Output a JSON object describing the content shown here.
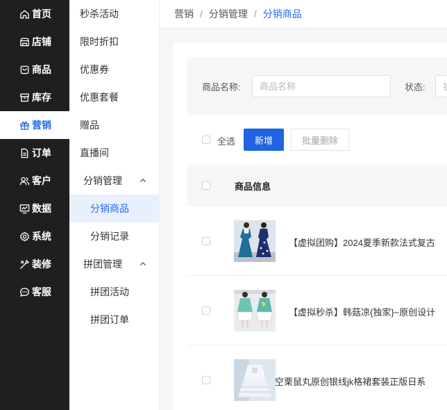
{
  "nav_primary": [
    {
      "label": "首页",
      "icon": "home-icon"
    },
    {
      "label": "店铺",
      "icon": "shop-icon"
    },
    {
      "label": "商品",
      "icon": "goods-icon"
    },
    {
      "label": "库存",
      "icon": "inventory-icon"
    },
    {
      "label": "营销",
      "icon": "gift-icon",
      "active": true
    },
    {
      "label": "订单",
      "icon": "order-icon"
    },
    {
      "label": "客户",
      "icon": "customer-icon"
    },
    {
      "label": "数据",
      "icon": "chart-icon"
    },
    {
      "label": "系统",
      "icon": "gear-icon"
    },
    {
      "label": "装修",
      "icon": "decoration-icon"
    },
    {
      "label": "客服",
      "icon": "chat-icon"
    }
  ],
  "nav_secondary": {
    "items": [
      "秒杀活动",
      "限时折扣",
      "优惠券",
      "优惠套餐",
      "赠品",
      "直播间"
    ],
    "group_distribution": {
      "label": "分销管理",
      "children": [
        "分销商品",
        "分销记录"
      ]
    },
    "group_pintuan": {
      "label": "拼团管理",
      "children": [
        "拼团活动",
        "拼团订单"
      ]
    }
  },
  "breadcrumb": [
    "营销",
    "分销管理",
    "分销商品"
  ],
  "breadcrumb_separator": "/",
  "filter": {
    "name_label": "商品名称:",
    "name_value": "",
    "name_placeholder": "商品名称",
    "status_label": "状态:",
    "status_placeholder": "状"
  },
  "toolbar": {
    "select_all_label": "全选",
    "add_label": "新增",
    "batch_delete_label": "批量删除"
  },
  "table": {
    "header": "商品信息",
    "rows": [
      {
        "name": "【虚拟团购】2024夏季新款法式复古"
      },
      {
        "name": "【虚拟秒杀】韩菇凉{独家}~原创设计"
      },
      {
        "name": "空栗鼠丸原创银线jk格裙套装正版日系"
      }
    ]
  },
  "colors": {
    "accent": "#2468f2",
    "primary_button": "#1f64e0",
    "sidebar_bg": "#1f1f1f"
  }
}
